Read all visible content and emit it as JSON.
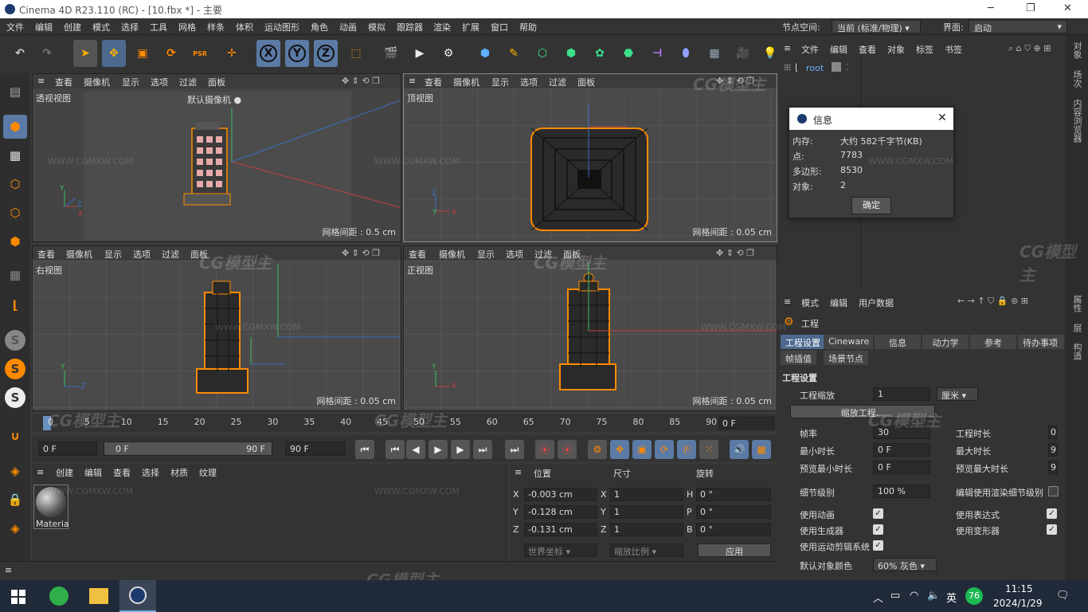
{
  "window": {
    "title": "Cinema 4D R23.110 (RC) - [10.fbx *] - 主要"
  },
  "menu": [
    "文件",
    "编辑",
    "创建",
    "模式",
    "选择",
    "工具",
    "网格",
    "样条",
    "体积",
    "运动图形",
    "角色",
    "动画",
    "模拟",
    "跟踪器",
    "渲染",
    "扩展",
    "窗口",
    "帮助"
  ],
  "menu_right": {
    "node_space_label": "节点空间:",
    "node_space_value": "当前 (标准/物理)",
    "layout_label": "界面:",
    "layout_value": "启动"
  },
  "toolbar": {
    "psr": "PSR",
    "x": "X",
    "y": "Y",
    "z": "Z"
  },
  "viewport_menu": [
    "查看",
    "摄像机",
    "显示",
    "选项",
    "过滤",
    "面板"
  ],
  "viewports": {
    "persp": {
      "name": "透视视图",
      "camera": "默认摄像机",
      "grid": "网格间距 : 0.5 cm"
    },
    "top": {
      "name": "顶视图",
      "grid": "网格间距 : 0.05 cm"
    },
    "right": {
      "name": "右视图",
      "grid": "网格间距 : 0.05 cm"
    },
    "front": {
      "name": "正视图",
      "grid": "网格间距 : 0.05 cm"
    }
  },
  "timeline": {
    "ticks": [
      "0",
      "5",
      "10",
      "15",
      "20",
      "25",
      "30",
      "35",
      "40",
      "45",
      "50",
      "55",
      "60",
      "65",
      "70",
      "75",
      "80",
      "85",
      "90"
    ],
    "current": "0 F"
  },
  "transport": {
    "start": "0 F",
    "range_start": "0 F",
    "range_end": "90 F",
    "end": "90 F"
  },
  "material_panel": {
    "menu": [
      "创建",
      "编辑",
      "查看",
      "选择",
      "材质",
      "纹理"
    ],
    "material_name": "Materia"
  },
  "coord_panel": {
    "headers": [
      "位置",
      "尺寸",
      "旋转"
    ],
    "rows": [
      {
        "axis": "X",
        "pos": "-0.003 cm",
        "size_axis": "X",
        "size": "1",
        "rot_axis": "H",
        "rot": "0 °"
      },
      {
        "axis": "Y",
        "pos": "-0.128 cm",
        "size_axis": "Y",
        "size": "1",
        "rot_axis": "P",
        "rot": "0 °"
      },
      {
        "axis": "Z",
        "pos": "-0.131 cm",
        "size_axis": "Z",
        "size": "1",
        "rot_axis": "B",
        "rot": "0 °"
      }
    ],
    "mode": "世界坐标",
    "scale": "缩放比例",
    "apply": "应用"
  },
  "object_manager": {
    "menu": [
      "文件",
      "编辑",
      "查看",
      "对象",
      "标签",
      "书签"
    ],
    "root": "root"
  },
  "info_dialog": {
    "title": "信息",
    "rows": [
      {
        "k": "内存:",
        "v": "大约 582千字节(KB)"
      },
      {
        "k": "点:",
        "v": "7783"
      },
      {
        "k": "多边形:",
        "v": "8530"
      },
      {
        "k": "对象:",
        "v": "2"
      }
    ],
    "ok": "确定"
  },
  "attribute_manager": {
    "menu": [
      "模式",
      "编辑",
      "用户数据"
    ],
    "object": "工程",
    "tabs_row1": [
      "工程设置",
      "Cineware",
      "信息",
      "动力学",
      "参考",
      "待办事项"
    ],
    "tabs_row2": [
      "帧插值",
      "场景节点"
    ],
    "section": "工程设置",
    "scale_label": "工程缩放",
    "scale_value": "1",
    "scale_unit": "厘米",
    "scale_button": "缩放工程...",
    "fps_label": "帧率",
    "fps_value": "30",
    "doc_len_label": "工程时长",
    "doc_len_value": "0",
    "min_time_label": "最小时长",
    "min_time_value": "0 F",
    "max_time_label": "最大时长",
    "max_time_value": "9",
    "prev_min_label": "预览最小时长",
    "prev_min_value": "0 F",
    "prev_max_label": "预览最大时长",
    "prev_max_value": "9",
    "lod_label": "细节级别",
    "lod_value": "100 %",
    "render_lod_label": "编辑使用渲染细节级别",
    "use_anim": "使用动画",
    "use_expr": "使用表达式",
    "use_gen": "使用生成器",
    "use_deform": "使用变形器",
    "use_motion": "使用运动剪辑系统",
    "default_color_label": "默认对象颜色",
    "default_color_value": "60% 灰色"
  },
  "side_tabs": [
    "对象",
    "场次",
    "内容浏览器",
    "属性",
    "层",
    "构造"
  ],
  "taskbar": {
    "lang": "英",
    "badge": "76",
    "time": "11:15",
    "date": "2024/1/29"
  },
  "watermark": {
    "logo": "CG模型主",
    "url": "WWW.CGMXW.COM"
  }
}
